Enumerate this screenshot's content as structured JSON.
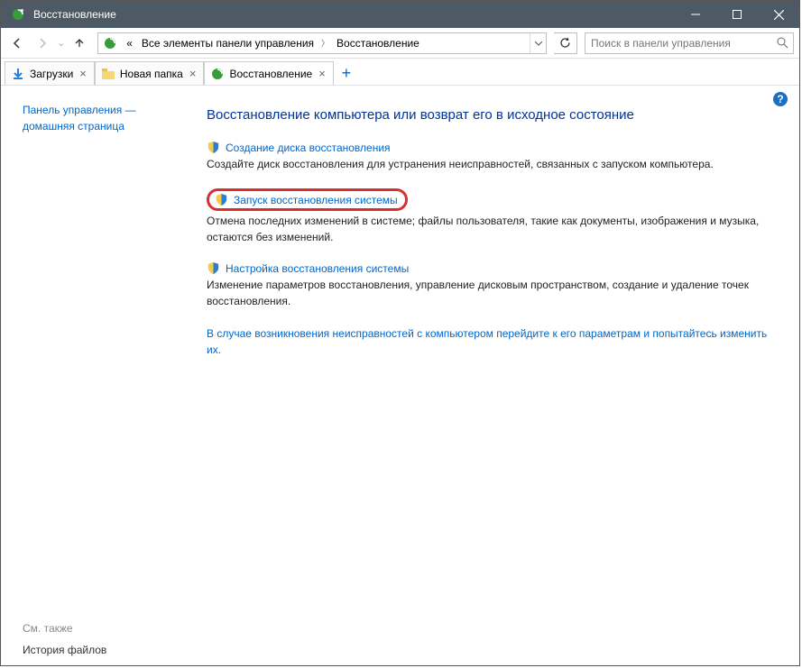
{
  "titlebar": {
    "title": "Восстановление"
  },
  "nav": {
    "crumb_prefix": "«",
    "crumb1": "Все элементы панели управления",
    "crumb2": "Восстановление",
    "search_placeholder": "Поиск в панели управления"
  },
  "tabs": {
    "t1": "Загрузки",
    "t2": "Новая папка",
    "t3": "Восстановление"
  },
  "sidebar": {
    "home": "Панель управления — домашняя страница",
    "see_also": "См. также",
    "history": "История файлов"
  },
  "content": {
    "heading": "Восстановление компьютера или возврат его в исходное состояние",
    "item1_link": "Создание диска восстановления",
    "item1_desc": "Создайте диск восстановления для устранения неисправностей, связанных с запуском компьютера.",
    "item2_link": "Запуск восстановления системы",
    "item2_desc": "Отмена последних изменений в системе; файлы пользователя, такие как документы, изображения и музыка, остаются без изменений.",
    "item3_link": "Настройка восстановления системы",
    "item3_desc": "Изменение параметров восстановления, управление дисковым пространством, создание и удаление точек восстановления.",
    "footer": "В случае возникновения неисправностей с компьютером перейдите к его параметрам и попытайтесь изменить их."
  }
}
